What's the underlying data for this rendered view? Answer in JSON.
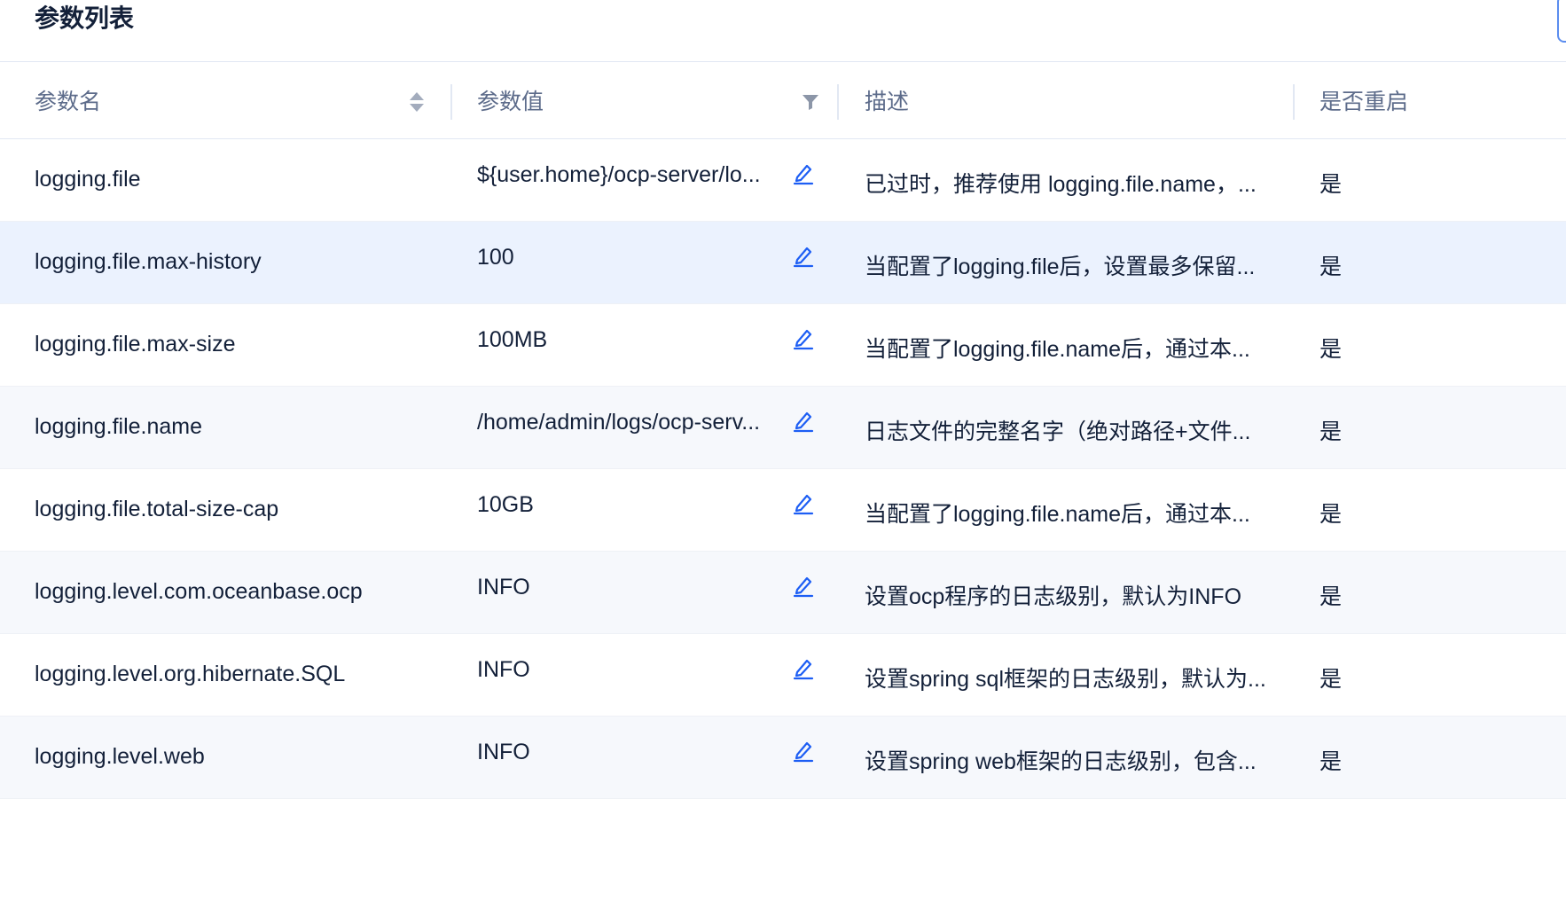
{
  "page": {
    "title": "参数列表"
  },
  "table": {
    "columns": {
      "name": "参数名",
      "value": "参数值",
      "desc": "描述",
      "restart": "是否重启"
    },
    "rows": [
      {
        "name": "logging.file",
        "value": "${user.home}/ocp-server/lo...",
        "desc": "已过时，推荐使用 logging.file.name，...",
        "restart": "是"
      },
      {
        "name": "logging.file.max-history",
        "value": "100",
        "desc": "当配置了logging.file后，设置最多保留...",
        "restart": "是"
      },
      {
        "name": "logging.file.max-size",
        "value": "100MB",
        "desc": "当配置了logging.file.name后，通过本...",
        "restart": "是"
      },
      {
        "name": "logging.file.name",
        "value": "/home/admin/logs/ocp-serv...",
        "desc": "日志文件的完整名字（绝对路径+文件...",
        "restart": "是"
      },
      {
        "name": "logging.file.total-size-cap",
        "value": "10GB",
        "desc": "当配置了logging.file.name后，通过本...",
        "restart": "是"
      },
      {
        "name": "logging.level.com.oceanbase.ocp",
        "value": "INFO",
        "desc": "设置ocp程序的日志级别，默认为INFO",
        "restart": "是"
      },
      {
        "name": "logging.level.org.hibernate.SQL",
        "value": "INFO",
        "desc": "设置spring sql框架的日志级别，默认为...",
        "restart": "是"
      },
      {
        "name": "logging.level.web",
        "value": "INFO",
        "desc": "设置spring web框架的日志级别，包含...",
        "restart": "是"
      }
    ]
  },
  "theme": {
    "accent": "#1d5ef4",
    "hover_row": "#ebf2fe",
    "alt_row": "#f6f8fc",
    "text": "#132039",
    "header_text": "#5c6b8a"
  },
  "icons": {
    "sort": "sort-icon",
    "filter": "filter-icon",
    "edit": "edit-icon"
  }
}
